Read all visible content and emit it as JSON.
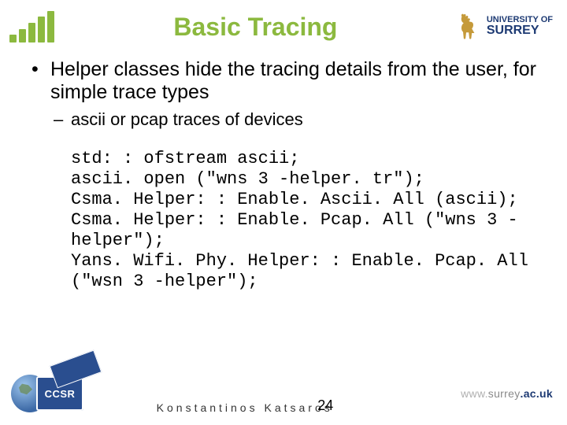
{
  "header": {
    "title": "Basic Tracing",
    "university_line1": "UNIVERSITY OF",
    "university_line2": "SURREY"
  },
  "bullet": {
    "main": "Helper classes hide the tracing details from the user, for simple trace types",
    "sub": "ascii or pcap traces of devices"
  },
  "code": {
    "l1": "std: : ofstream ascii;",
    "l2": "ascii. open (\"wns 3 -helper. tr\");",
    "l3": "Csma. Helper: : Enable. Ascii. All (ascii);",
    "l4": "Csma. Helper: : Enable. Pcap. All (\"wns 3 - helper\");",
    "l5": "Yans. Wifi. Phy. Helper: : Enable. Pcap. All (\"wsn 3 -helper\");"
  },
  "footer": {
    "ccsr": "CCSR",
    "author": "Konstantinos Katsaros",
    "page": "24",
    "url_www": "www.",
    "url_mid": "surrey",
    "url_end": ".ac.uk"
  }
}
